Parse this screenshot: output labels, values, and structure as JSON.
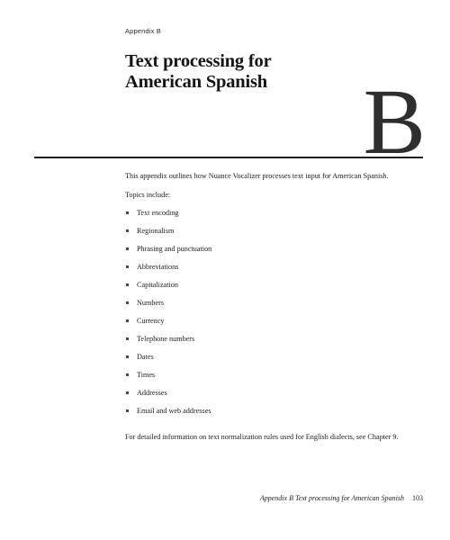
{
  "page": {
    "running_head": "Appendix B",
    "drop_letter": "B",
    "title_lines": [
      "Text processing for",
      "American Spanish"
    ],
    "intro_paragraph": "This appendix outlines how Nuance Vocalizer processes text input for American Spanish.",
    "topics_lead_in": "Topics include:",
    "topics": [
      "Text encoding",
      "Regionalism",
      "Phrasing and punctuation",
      "Abbreviations",
      "Capitalization",
      "Numbers",
      "Currency",
      "Telephone numbers",
      "Dates",
      "Times",
      "Addresses",
      "Email and web addresses"
    ],
    "closing_paragraph": "For detailed information on text normalization rules used for English dialects, see Chapter 9.",
    "footer": {
      "text": "Appendix B Text processing for American Spanish",
      "page_number": "103"
    },
    "colors": {
      "background": "#ffffff",
      "text": "#1c1c1c",
      "rule": "#1f1f1f",
      "drop_letter": "#2e2e2e",
      "bullet": "#4a4a4a"
    }
  }
}
